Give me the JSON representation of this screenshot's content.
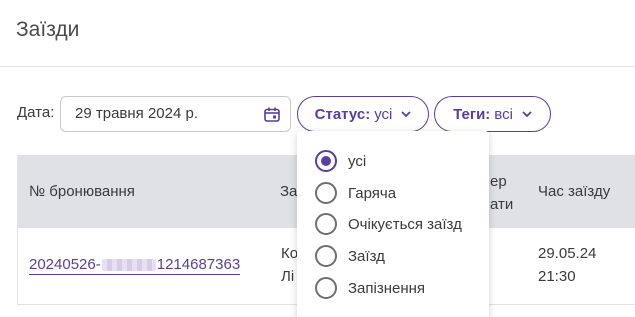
{
  "page": {
    "title": "Заїзди"
  },
  "filters": {
    "date_label": "Дата:",
    "date_value": "29 травня 2024 р.",
    "status": {
      "key": "Статус:",
      "value": "усі"
    },
    "tags": {
      "key": "Теги:",
      "value": "всі"
    }
  },
  "status_dropdown": {
    "options": [
      {
        "label": "усі",
        "selected": true
      },
      {
        "label": "Гаряча",
        "selected": false
      },
      {
        "label": "Очікується заїзд",
        "selected": false
      },
      {
        "label": "Заїзд",
        "selected": false
      },
      {
        "label": "Запізнення",
        "selected": false
      }
    ]
  },
  "table": {
    "headers": {
      "booking": "№ бронювання",
      "guest_partial": "За",
      "room_partial_1": "ер",
      "room_partial_2": "ати",
      "checkin_time": "Час заїзду"
    },
    "rows": [
      {
        "booking_prefix": "20240526-",
        "booking_suffix": "1214687363",
        "guest_line1": "Ко",
        "guest_line2": "Лі",
        "checkin_date": "29.05.24",
        "checkin_clock": "21:30"
      }
    ]
  },
  "colors": {
    "accent": "#5a3da0",
    "header_bg": "#dfe1e4"
  }
}
